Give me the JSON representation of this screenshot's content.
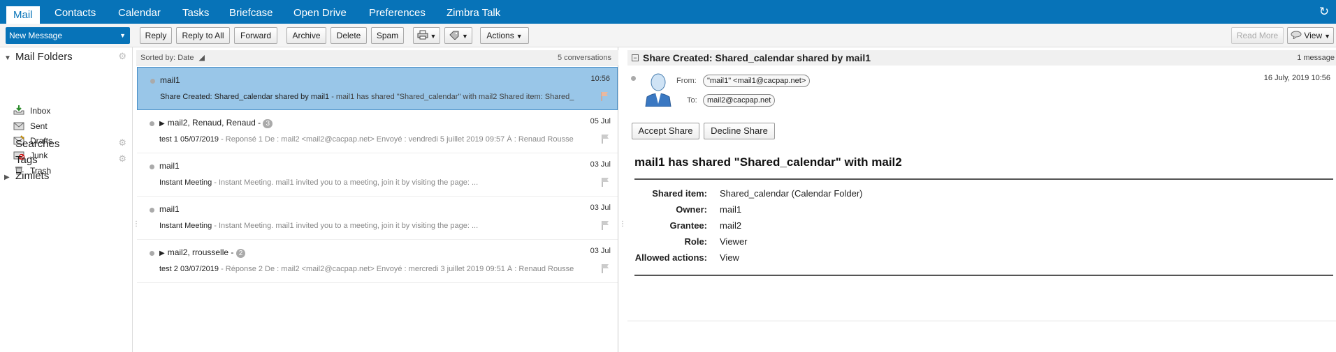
{
  "app_tabs": [
    "Mail",
    "Contacts",
    "Calendar",
    "Tasks",
    "Briefcase",
    "Open Drive",
    "Preferences",
    "Zimbra Talk"
  ],
  "toolbar": {
    "new_message": "New Message",
    "reply": "Reply",
    "reply_all": "Reply to All",
    "forward": "Forward",
    "archive": "Archive",
    "delete": "Delete",
    "spam": "Spam",
    "actions": "Actions",
    "read_more": "Read More",
    "view": "View"
  },
  "sidebar": {
    "mail_folders": "Mail Folders",
    "folders": [
      "Inbox",
      "Sent",
      "Drafts",
      "Junk",
      "Trash"
    ],
    "searches": "Searches",
    "tags": "Tags",
    "zimlets": "Zimlets"
  },
  "list": {
    "sort_label": "Sorted by: Date",
    "count": "5 conversations",
    "rows": [
      {
        "from": "mail1",
        "badge": "",
        "date": "10:56",
        "subject": "Share Created: Shared_calendar shared by mail1",
        "fragment": " - mail1 has shared \"Shared_calendar\" with mail2 Shared item: Shared_",
        "expander": false
      },
      {
        "from": "mail2, Renaud, Renaud -",
        "badge": "3",
        "date": "05 Jul",
        "subject": "test 1 05/07/2019",
        "fragment": " - Reponsé 1 De : mail2 <mail2@cacpap.net> Envoyé : vendredi 5 juillet 2019 09:57 À : Renaud Rousse",
        "expander": true
      },
      {
        "from": "mail1",
        "badge": "",
        "date": "03 Jul",
        "subject": "Instant Meeting",
        "fragment": " - Instant Meeting. mail1 invited you to a meeting, join it by visiting the page: ...",
        "expander": false
      },
      {
        "from": "mail1",
        "badge": "",
        "date": "03 Jul",
        "subject": "Instant Meeting",
        "fragment": " - Instant Meeting. mail1 invited you to a meeting, join it by visiting the page: ...",
        "expander": false
      },
      {
        "from": "mail2, rrousselle -",
        "badge": "2",
        "date": "03 Jul",
        "subject": "test 2 03/07/2019",
        "fragment": " - Réponse 2 De : mail2 <mail2@cacpap.net> Envoyé : mercredi 3 juillet 2019 09:51 À : Renaud Rousse",
        "expander": true
      }
    ]
  },
  "reader": {
    "header": "Share Created: Shared_calendar shared by mail1",
    "message_count": "1 message",
    "from_label": "From:",
    "from_value": "\"mail1\" <mail1@cacpap.net>",
    "to_label": "To:",
    "to_value": "mail2@cacpap.net",
    "date": "16 July, 2019 10:56",
    "accept_share": "Accept Share",
    "decline_share": "Decline Share",
    "body_title": "mail1 has shared \"Shared_calendar\" with mail2",
    "details": [
      {
        "key": "Shared item:",
        "value": "Shared_calendar (Calendar Folder)"
      },
      {
        "key": "Owner:",
        "value": "mail1"
      },
      {
        "key": "Grantee:",
        "value": "mail2"
      },
      {
        "key": "Role:",
        "value": "Viewer"
      },
      {
        "key": "Allowed actions:",
        "value": "View"
      }
    ]
  },
  "colors": {
    "brand": "#0773b8",
    "selected_row": "#99c6e8"
  }
}
